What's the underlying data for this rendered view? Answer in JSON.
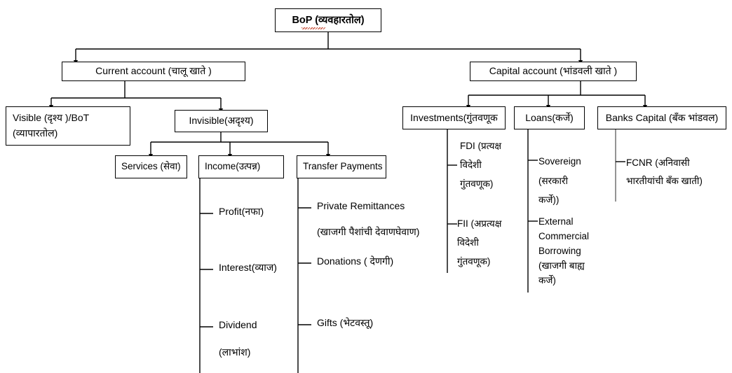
{
  "diagram": {
    "title_node": {
      "lines": [
        "BoP (व्यवहारतोल)"
      ]
    },
    "level2": [
      {
        "id": "current-account",
        "lines": [
          "Current account (चालू खाते  )"
        ]
      },
      {
        "id": "capital-account",
        "lines": [
          "Capital account (भांडवली खाते  )"
        ]
      }
    ],
    "level3": [
      {
        "id": "visible-bot",
        "lines": [
          "Visible (दृश्य )/BoT",
          "(व्यापारतोल)"
        ]
      },
      {
        "id": "invisible",
        "lines": [
          "Invisible(अदृश्य)"
        ]
      },
      {
        "id": "investments",
        "lines": [
          "Investments(गुंतवणूक"
        ]
      },
      {
        "id": "loans",
        "lines": [
          "Loans(कर्जे)"
        ]
      },
      {
        "id": "banks-capital",
        "lines": [
          "Banks Capital  (बँक  भांडवल)"
        ]
      }
    ],
    "level4": [
      {
        "id": "services",
        "lines": [
          "Services (सेवा)"
        ]
      },
      {
        "id": "income",
        "lines": [
          "Income(उत्पन्न)"
        ]
      },
      {
        "id": "transfer-payments",
        "lines": [
          "Transfer Payments"
        ]
      }
    ],
    "leaves": {
      "income_items": [
        {
          "id": "profit",
          "lines": [
            "Profit(नफा)"
          ]
        },
        {
          "id": "interest",
          "lines": [
            "Interest(व्याज)"
          ]
        },
        {
          "id": "dividend",
          "lines": [
            "Dividend",
            "(लाभांश)"
          ]
        }
      ],
      "transfer_items": [
        {
          "id": "private-remittances",
          "lines": [
            "Private  Remittances",
            "(खाजगी   पैशांची  देवाणघेवाण)"
          ]
        },
        {
          "id": "donations",
          "lines": [
            "Donations (  देणगी)"
          ]
        },
        {
          "id": "gifts",
          "lines": [
            "Gifts  (भेटवस्तू)"
          ]
        }
      ],
      "investment_items": [
        {
          "id": "fdi",
          "lines": [
            "FDI  (प्रत्यक्ष",
            "विदेशी",
            "गुंतवणूक)"
          ]
        },
        {
          "id": "fii",
          "lines": [
            "FII  (अप्रत्यक्ष",
            "विदेशी",
            "गुंतवणूक)"
          ]
        }
      ],
      "loan_items": [
        {
          "id": "sovereign",
          "lines": [
            "Sovereign",
            "(सरकारी",
            "कर्जे))"
          ]
        },
        {
          "id": "external-commercial-borrowing",
          "lines": [
            "External",
            "Commercial",
            "Borrowing",
            "(खाजगी  बाह्य",
            "कर्जे)"
          ]
        }
      ],
      "banks_capital_items": [
        {
          "id": "fcnr",
          "lines": [
            "FCNR  (अनिवासी",
            "भारतीयांची  बँक  खाती)"
          ]
        }
      ]
    },
    "colors": {
      "line": "#000000",
      "line_gray": "#7a7a7a",
      "background": "#ffffff",
      "text": "#000000",
      "spell_underline": "#c23b22"
    }
  }
}
